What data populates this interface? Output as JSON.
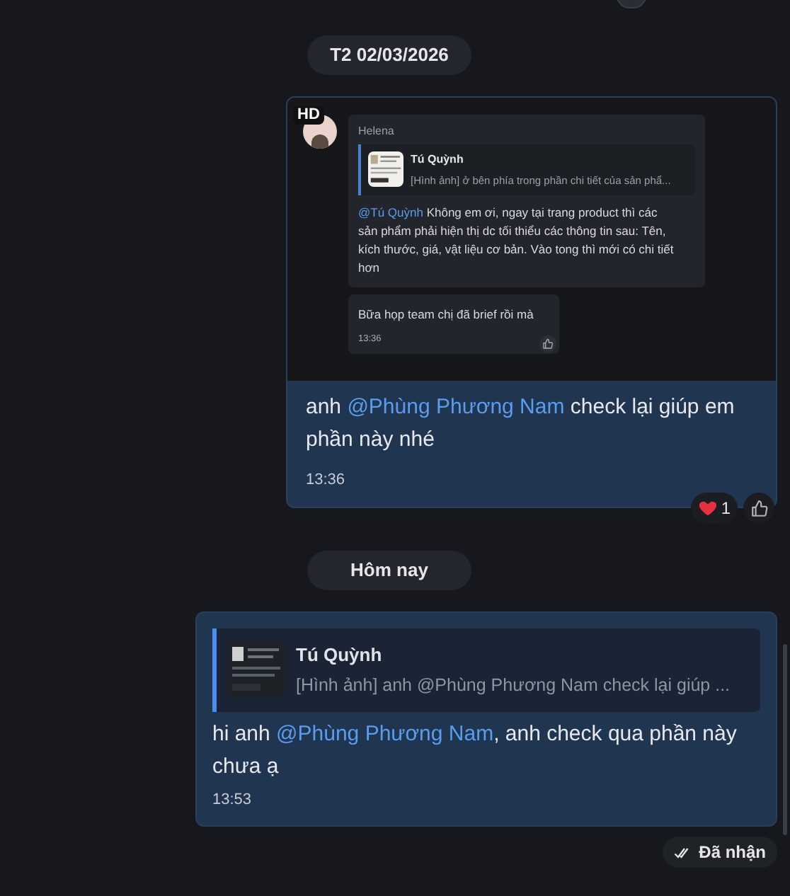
{
  "day_groups": [
    {
      "date": "T2 02/03/2026",
      "messages": [
        {
          "kind": "image_message",
          "image": {
            "badge": "HD",
            "sender": "Helena",
            "quote": {
              "author": "Tú Quỳnh",
              "text": "[Hình ảnh] ở bên phía trong phần chi tiết của sản phẩ..."
            },
            "text": [
              {
                "kind": "mention",
                "text": "@Tú Quỳnh"
              },
              {
                "kind": "plain",
                "text": " Không em ơi, ngay tại trang product thì các sản phẩm phải hiện thị dc tối thiểu các thông tin sau: Tên, kích thước, giá, vật liệu cơ bản. Vào tong thì mới có chi tiết hơn"
              }
            ],
            "reply": {
              "text": "Bữa họp team chị đã brief rồi mà",
              "time": "13:36"
            }
          },
          "text": [
            {
              "kind": "plain",
              "text": "anh "
            },
            {
              "kind": "mention",
              "text": "@Phùng Phương Nam"
            },
            {
              "kind": "plain",
              "text": " check lại giúp em phần này nhé"
            }
          ],
          "time": "13:36",
          "reactions": [
            {
              "kind": "heart",
              "count": "1"
            }
          ]
        }
      ]
    },
    {
      "date": "Hôm nay",
      "messages": [
        {
          "kind": "reply_message",
          "quote": {
            "author": "Tú Quỳnh",
            "text": "[Hình ảnh] anh @Phùng Phương Nam check lại giúp ..."
          },
          "text": [
            {
              "kind": "plain",
              "text": "hi anh "
            },
            {
              "kind": "mention",
              "text": "@Phùng Phương Nam"
            },
            {
              "kind": "plain",
              "text": ", anh check qua phần này chưa ạ"
            }
          ],
          "time": "13:53",
          "status": "Đã nhận"
        }
      ]
    }
  ]
}
